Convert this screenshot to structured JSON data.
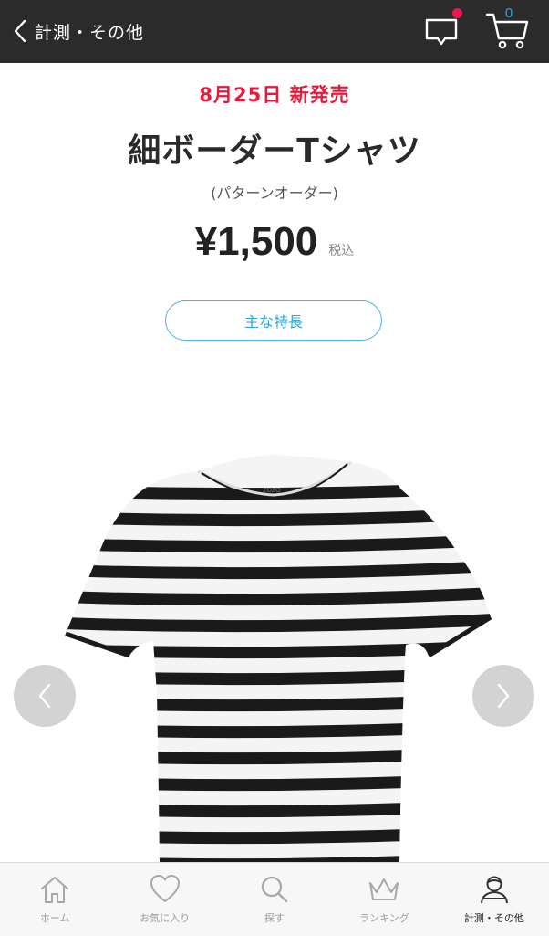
{
  "header": {
    "back_label": "計測・その他",
    "cart_count": "0"
  },
  "product": {
    "release": "8月25日 新発売",
    "title": "細ボーダーTシャツ",
    "subtitle": "(パターンオーダー)",
    "price": "¥1,500",
    "tax_label": "税込",
    "features_button": "主な特長",
    "shirt_logo": "ZOZO"
  },
  "tabs": [
    {
      "label": "ホーム",
      "icon": "home-icon"
    },
    {
      "label": "お気に入り",
      "icon": "heart-icon"
    },
    {
      "label": "探す",
      "icon": "search-icon"
    },
    {
      "label": "ランキング",
      "icon": "crown-icon"
    },
    {
      "label": "計測・その他",
      "icon": "person-icon",
      "active": true
    }
  ],
  "colors": {
    "header_bg": "#2b2b2b",
    "accent_red": "#e8193c",
    "accent_blue": "#2ea8e0",
    "stripe": "#1a1a1a"
  }
}
